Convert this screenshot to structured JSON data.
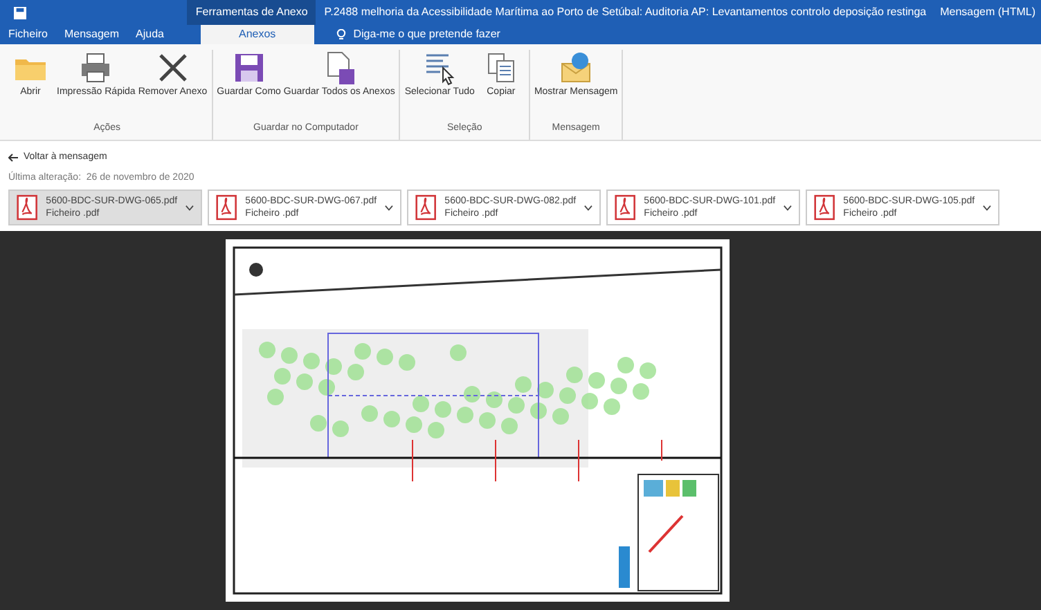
{
  "window": {
    "contextual_tab": "Ferramentas de Anexo",
    "title": "P.2488 melhoria da Acessibilidade Marítima ao Porto de Setúbal: Auditoria AP: Levantamentos controlo deposição restinga",
    "app_suffix": "Mensagem (HTML)"
  },
  "tabs": [
    {
      "label": "Ficheiro",
      "selected": false
    },
    {
      "label": "Mensagem",
      "selected": false
    },
    {
      "label": "Ajuda",
      "selected": false
    },
    {
      "label": "Anexos",
      "selected": true
    }
  ],
  "search": {
    "placeholder": "Diga-me o que pretende fazer"
  },
  "ribbon": [
    {
      "group": "Ações",
      "buttons": [
        {
          "label": "Abrir",
          "kind": "folder"
        },
        {
          "label": "Impressão Rápida",
          "kind": "printer"
        },
        {
          "label": "Remover Anexo",
          "kind": "x"
        }
      ]
    },
    {
      "group": "Guardar no Computador",
      "buttons": [
        {
          "label": "Guardar Como",
          "kind": "save"
        },
        {
          "label": "Guardar Todos os Anexos",
          "kind": "saveall"
        }
      ]
    },
    {
      "group": "Seleção",
      "buttons": [
        {
          "label": "Selecionar Tudo",
          "kind": "select"
        },
        {
          "label": "Copiar",
          "kind": "copy"
        }
      ]
    },
    {
      "group": "Mensagem",
      "buttons": [
        {
          "label": "Mostrar Mensagem",
          "kind": "mail"
        }
      ]
    }
  ],
  "back_link": "Voltar à mensagem",
  "modified": "Última alteração:  26 de novembro de 2020",
  "attachments": [
    {
      "name": "5600-BDC-SUR-DWG-065.pdf",
      "type": "Ficheiro .pdf",
      "selected": true
    },
    {
      "name": "5600-BDC-SUR-DWG-067.pdf",
      "type": "Ficheiro .pdf",
      "selected": false
    },
    {
      "name": "5600-BDC-SUR-DWG-082.pdf",
      "type": "Ficheiro .pdf",
      "selected": false
    },
    {
      "name": "5600-BDC-SUR-DWG-101.pdf",
      "type": "Ficheiro .pdf",
      "selected": false
    },
    {
      "name": "5600-BDC-SUR-DWG-105.pdf",
      "type": "Ficheiro .pdf",
      "selected": false
    }
  ]
}
